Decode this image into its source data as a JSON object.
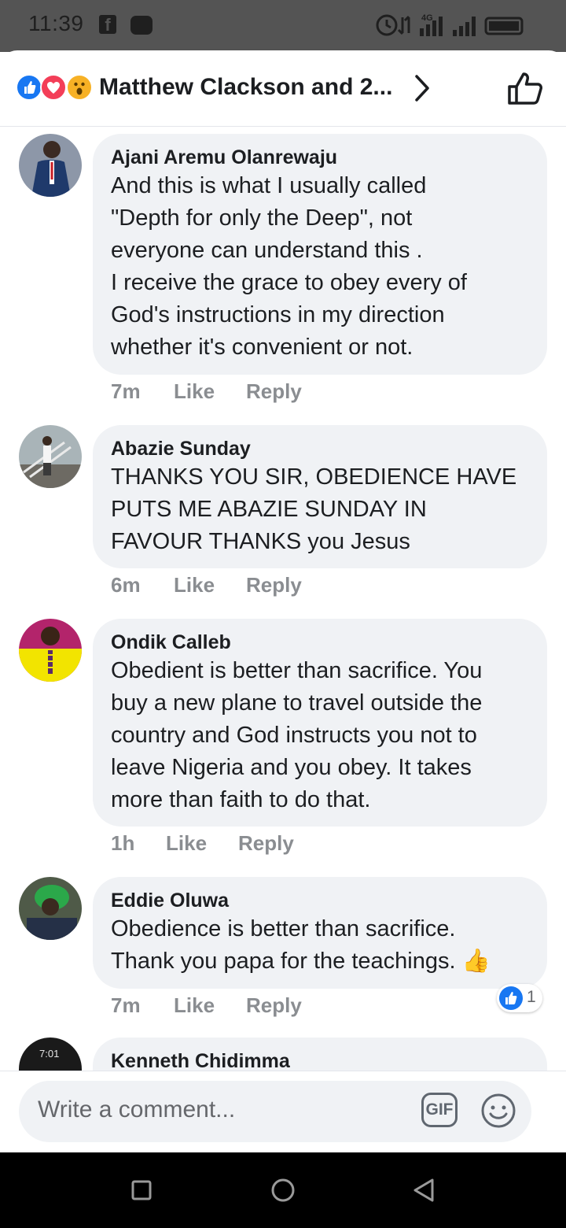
{
  "status_bar": {
    "time": "11:39",
    "network": "4G"
  },
  "header": {
    "title": "Matthew Clackson and 2..."
  },
  "comments": [
    {
      "author": "Ajani Aremu Olanrewaju",
      "text": "And this is what I usually called\n\"Depth for only the Deep\", not\neveryone can understand this .\nI receive the grace to obey every of\nGod's instructions in my direction\nwhether it's convenient or not.",
      "time": "7m",
      "like": "Like",
      "reply": "Reply"
    },
    {
      "author": "Abazie Sunday",
      "text": "THANKS YOU SIR, OBEDIENCE HAVE\nPUTS ME ABAZIE SUNDAY IN\nFAVOUR THANKS you Jesus",
      "time": "6m",
      "like": "Like",
      "reply": "Reply"
    },
    {
      "author": "Ondik Calleb",
      "text": "Obedient is better than sacrifice. You\nbuy a new plane to travel outside the\ncountry and God instructs you not to\nleave Nigeria and you obey. It takes\nmore than faith to do that.",
      "time": "1h",
      "like": "Like",
      "reply": "Reply"
    },
    {
      "author": "Eddie Oluwa",
      "text": "Obedience is better than sacrifice.\nThank you papa for the teachings. 👍",
      "time": "7m",
      "like": "Like",
      "reply": "Reply",
      "reaction_count": "1"
    },
    {
      "author": "Kenneth Chidimma",
      "avatar_caption": "7:01"
    }
  ],
  "composer": {
    "placeholder": "Write a comment...",
    "gif_label": "GIF"
  },
  "colors": {
    "bubble": "#f0f2f5",
    "like_blue": "#1877f2",
    "love_red": "#f33e58",
    "muted": "#8a8d91"
  }
}
